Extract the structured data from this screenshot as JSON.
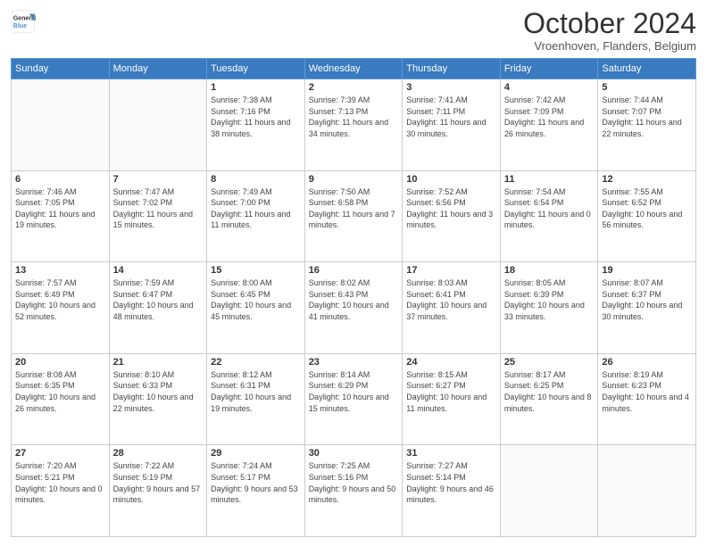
{
  "logo": {
    "line1": "General",
    "line2": "Blue"
  },
  "title": "October 2024",
  "subtitle": "Vroenhoven, Flanders, Belgium",
  "days_of_week": [
    "Sunday",
    "Monday",
    "Tuesday",
    "Wednesday",
    "Thursday",
    "Friday",
    "Saturday"
  ],
  "weeks": [
    [
      {
        "day": "",
        "info": ""
      },
      {
        "day": "",
        "info": ""
      },
      {
        "day": "1",
        "info": "Sunrise: 7:38 AM\nSunset: 7:16 PM\nDaylight: 11 hours and 38 minutes."
      },
      {
        "day": "2",
        "info": "Sunrise: 7:39 AM\nSunset: 7:13 PM\nDaylight: 11 hours and 34 minutes."
      },
      {
        "day": "3",
        "info": "Sunrise: 7:41 AM\nSunset: 7:11 PM\nDaylight: 11 hours and 30 minutes."
      },
      {
        "day": "4",
        "info": "Sunrise: 7:42 AM\nSunset: 7:09 PM\nDaylight: 11 hours and 26 minutes."
      },
      {
        "day": "5",
        "info": "Sunrise: 7:44 AM\nSunset: 7:07 PM\nDaylight: 11 hours and 22 minutes."
      }
    ],
    [
      {
        "day": "6",
        "info": "Sunrise: 7:46 AM\nSunset: 7:05 PM\nDaylight: 11 hours and 19 minutes."
      },
      {
        "day": "7",
        "info": "Sunrise: 7:47 AM\nSunset: 7:02 PM\nDaylight: 11 hours and 15 minutes."
      },
      {
        "day": "8",
        "info": "Sunrise: 7:49 AM\nSunset: 7:00 PM\nDaylight: 11 hours and 11 minutes."
      },
      {
        "day": "9",
        "info": "Sunrise: 7:50 AM\nSunset: 6:58 PM\nDaylight: 11 hours and 7 minutes."
      },
      {
        "day": "10",
        "info": "Sunrise: 7:52 AM\nSunset: 6:56 PM\nDaylight: 11 hours and 3 minutes."
      },
      {
        "day": "11",
        "info": "Sunrise: 7:54 AM\nSunset: 6:54 PM\nDaylight: 11 hours and 0 minutes."
      },
      {
        "day": "12",
        "info": "Sunrise: 7:55 AM\nSunset: 6:52 PM\nDaylight: 10 hours and 56 minutes."
      }
    ],
    [
      {
        "day": "13",
        "info": "Sunrise: 7:57 AM\nSunset: 6:49 PM\nDaylight: 10 hours and 52 minutes."
      },
      {
        "day": "14",
        "info": "Sunrise: 7:59 AM\nSunset: 6:47 PM\nDaylight: 10 hours and 48 minutes."
      },
      {
        "day": "15",
        "info": "Sunrise: 8:00 AM\nSunset: 6:45 PM\nDaylight: 10 hours and 45 minutes."
      },
      {
        "day": "16",
        "info": "Sunrise: 8:02 AM\nSunset: 6:43 PM\nDaylight: 10 hours and 41 minutes."
      },
      {
        "day": "17",
        "info": "Sunrise: 8:03 AM\nSunset: 6:41 PM\nDaylight: 10 hours and 37 minutes."
      },
      {
        "day": "18",
        "info": "Sunrise: 8:05 AM\nSunset: 6:39 PM\nDaylight: 10 hours and 33 minutes."
      },
      {
        "day": "19",
        "info": "Sunrise: 8:07 AM\nSunset: 6:37 PM\nDaylight: 10 hours and 30 minutes."
      }
    ],
    [
      {
        "day": "20",
        "info": "Sunrise: 8:08 AM\nSunset: 6:35 PM\nDaylight: 10 hours and 26 minutes."
      },
      {
        "day": "21",
        "info": "Sunrise: 8:10 AM\nSunset: 6:33 PM\nDaylight: 10 hours and 22 minutes."
      },
      {
        "day": "22",
        "info": "Sunrise: 8:12 AM\nSunset: 6:31 PM\nDaylight: 10 hours and 19 minutes."
      },
      {
        "day": "23",
        "info": "Sunrise: 8:14 AM\nSunset: 6:29 PM\nDaylight: 10 hours and 15 minutes."
      },
      {
        "day": "24",
        "info": "Sunrise: 8:15 AM\nSunset: 6:27 PM\nDaylight: 10 hours and 11 minutes."
      },
      {
        "day": "25",
        "info": "Sunrise: 8:17 AM\nSunset: 6:25 PM\nDaylight: 10 hours and 8 minutes."
      },
      {
        "day": "26",
        "info": "Sunrise: 8:19 AM\nSunset: 6:23 PM\nDaylight: 10 hours and 4 minutes."
      }
    ],
    [
      {
        "day": "27",
        "info": "Sunrise: 7:20 AM\nSunset: 5:21 PM\nDaylight: 10 hours and 0 minutes."
      },
      {
        "day": "28",
        "info": "Sunrise: 7:22 AM\nSunset: 5:19 PM\nDaylight: 9 hours and 57 minutes."
      },
      {
        "day": "29",
        "info": "Sunrise: 7:24 AM\nSunset: 5:17 PM\nDaylight: 9 hours and 53 minutes."
      },
      {
        "day": "30",
        "info": "Sunrise: 7:25 AM\nSunset: 5:16 PM\nDaylight: 9 hours and 50 minutes."
      },
      {
        "day": "31",
        "info": "Sunrise: 7:27 AM\nSunset: 5:14 PM\nDaylight: 9 hours and 46 minutes."
      },
      {
        "day": "",
        "info": ""
      },
      {
        "day": "",
        "info": ""
      }
    ]
  ]
}
